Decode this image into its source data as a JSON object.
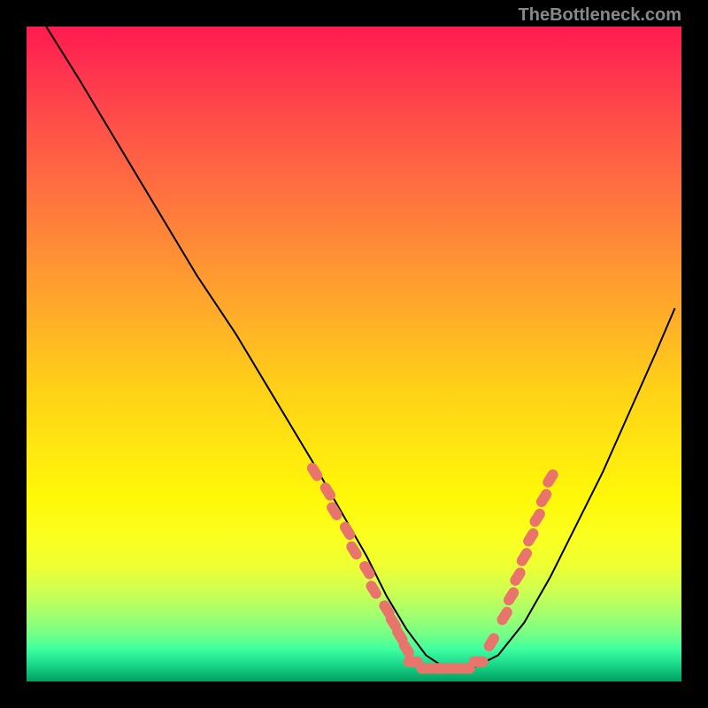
{
  "watermark": "TheBottleneck.com",
  "chart_data": {
    "type": "line",
    "title": "",
    "xlabel": "",
    "ylabel": "",
    "xlim": [
      0,
      100
    ],
    "ylim": [
      0,
      100
    ],
    "background": "rainbow-gradient-vertical",
    "series": [
      {
        "name": "curve",
        "color": "#000000",
        "x": [
          3,
          8,
          14,
          20,
          26,
          32,
          38,
          44,
          48,
          52,
          55,
          58,
          61,
          64,
          68,
          72,
          76,
          80,
          84,
          88,
          92,
          96,
          99
        ],
        "y": [
          100,
          92,
          82,
          72,
          62,
          53,
          43,
          33,
          26,
          19,
          13,
          8,
          4,
          2,
          2,
          4,
          9,
          16,
          24,
          32,
          41,
          50,
          57
        ]
      }
    ],
    "markers": [
      {
        "name": "left-cluster",
        "color": "#e8746b",
        "points": [
          {
            "x": 44,
            "y": 32
          },
          {
            "x": 46,
            "y": 29
          },
          {
            "x": 47,
            "y": 26
          },
          {
            "x": 49,
            "y": 23
          },
          {
            "x": 50,
            "y": 20
          },
          {
            "x": 52,
            "y": 17
          },
          {
            "x": 53,
            "y": 14
          },
          {
            "x": 55,
            "y": 11
          },
          {
            "x": 56,
            "y": 9
          },
          {
            "x": 57,
            "y": 7
          },
          {
            "x": 58,
            "y": 5
          }
        ]
      },
      {
        "name": "bottom-cluster",
        "color": "#e8746b",
        "points": [
          {
            "x": 59,
            "y": 3
          },
          {
            "x": 61,
            "y": 2
          },
          {
            "x": 63,
            "y": 2
          },
          {
            "x": 65,
            "y": 2
          },
          {
            "x": 67,
            "y": 2
          },
          {
            "x": 69,
            "y": 3
          }
        ]
      },
      {
        "name": "right-cluster",
        "color": "#e8746b",
        "points": [
          {
            "x": 71,
            "y": 6
          },
          {
            "x": 73,
            "y": 10
          },
          {
            "x": 74,
            "y": 13
          },
          {
            "x": 75,
            "y": 16
          },
          {
            "x": 76,
            "y": 19
          },
          {
            "x": 77,
            "y": 22
          },
          {
            "x": 78,
            "y": 25
          },
          {
            "x": 79,
            "y": 28
          },
          {
            "x": 80,
            "y": 31
          }
        ]
      }
    ]
  }
}
